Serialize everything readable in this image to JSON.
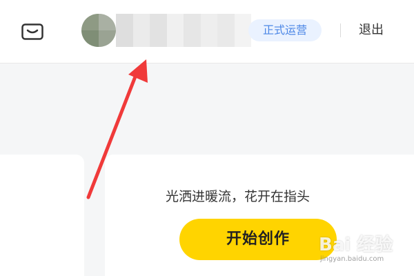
{
  "header": {
    "mail_icon": "mail-icon",
    "status_badge": "正式运营",
    "logout_label": "退出",
    "username_blurred": true
  },
  "hero": {
    "slogan": "光洒进暖流，花开在指头",
    "create_button_label": "开始创作"
  },
  "watermark": {
    "logo_text": "Bai 经验",
    "url": "jingyan.baidu.com"
  },
  "colors": {
    "accent_button": "#ffd400",
    "badge_bg": "#eaf2ff",
    "badge_text": "#4b86e6",
    "annotation_arrow": "#f03a3a",
    "page_bg": "#f5f6f7"
  }
}
